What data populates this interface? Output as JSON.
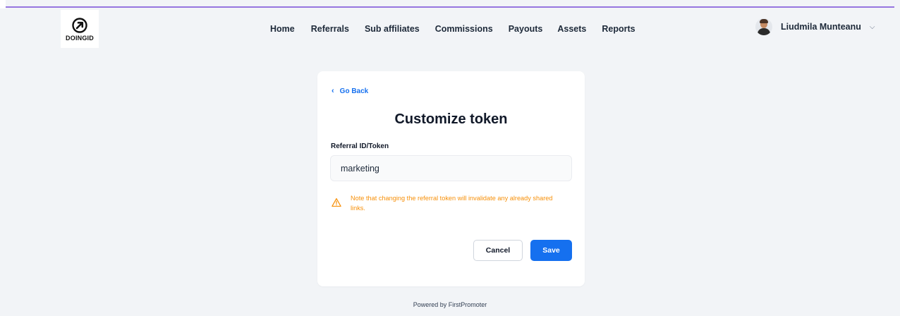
{
  "brand": {
    "logo_text": "DOINGID"
  },
  "nav": {
    "items": [
      {
        "label": "Home"
      },
      {
        "label": "Referrals"
      },
      {
        "label": "Sub affiliates"
      },
      {
        "label": "Commissions"
      },
      {
        "label": "Payouts"
      },
      {
        "label": "Assets"
      },
      {
        "label": "Reports"
      }
    ]
  },
  "user": {
    "name": "Liudmila Munteanu",
    "dropdown_icon": "chevron-down-icon"
  },
  "card": {
    "back_label": "Go Back",
    "title": "Customize token",
    "field_label": "Referral ID/Token",
    "field_value": "marketing",
    "warning_icon": "warning-triangle-icon",
    "warning_text": "Note that changing the referral token will invalidate any already shared links.",
    "cancel_label": "Cancel",
    "save_label": "Save"
  },
  "footer": {
    "text": "Powered by FirstPromoter"
  },
  "colors": {
    "accent": "#1570ef",
    "warning": "#f79009",
    "top_border": "#7f56d9",
    "background": "#f2f4f7"
  }
}
